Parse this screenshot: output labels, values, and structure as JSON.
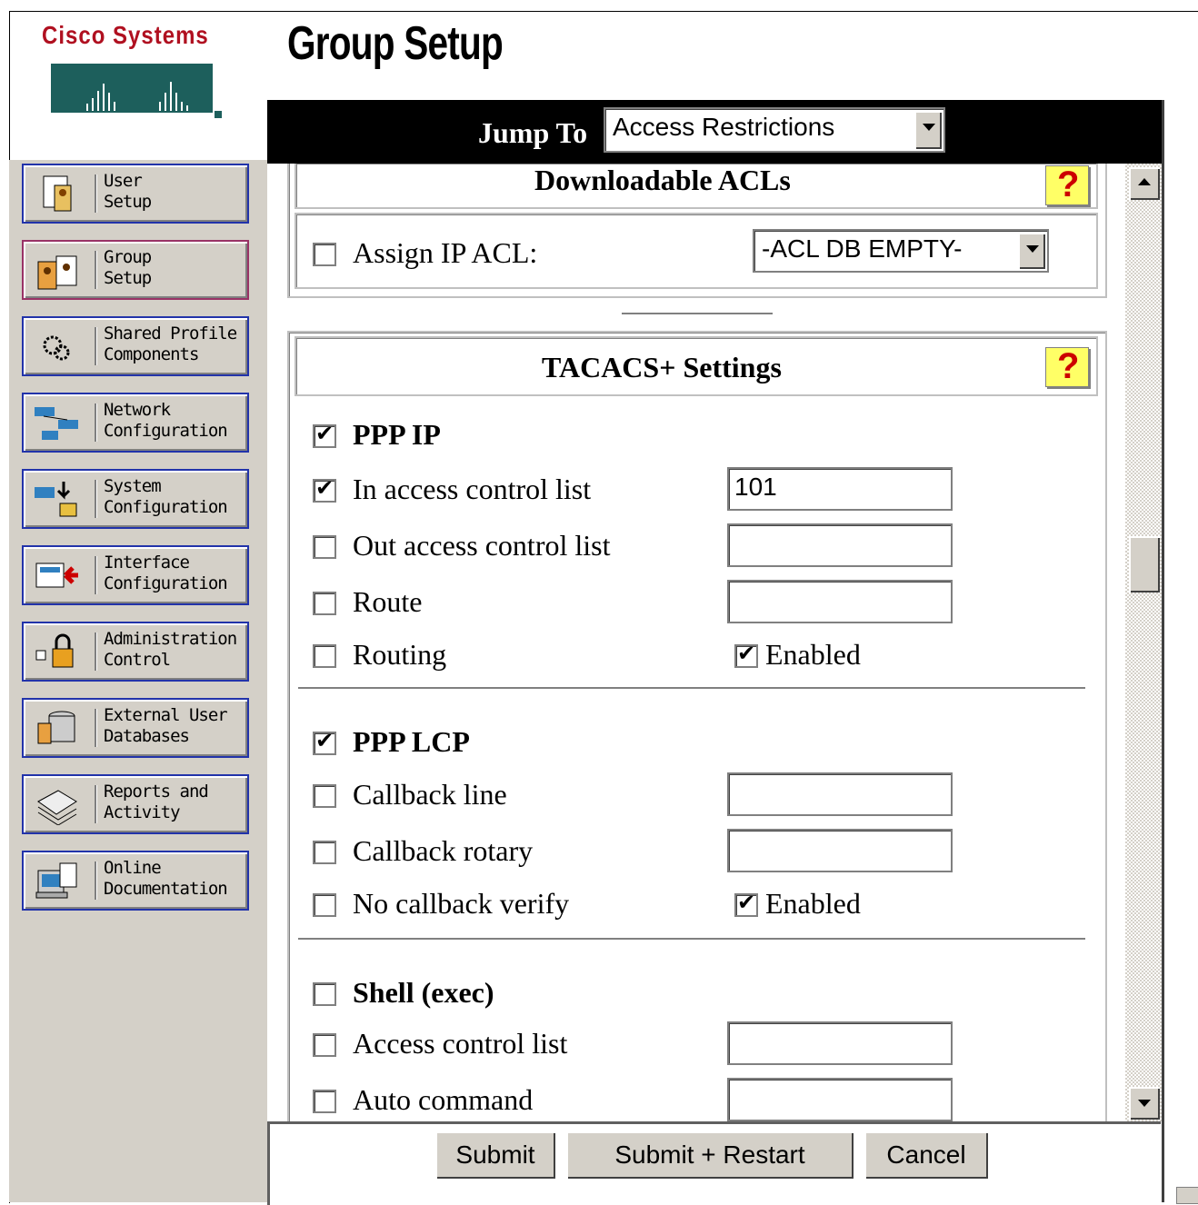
{
  "header": {
    "brand": "Cisco Systems",
    "page_title": "Group Setup"
  },
  "nav": {
    "items": [
      {
        "label": "User\nSetup",
        "icon": "user-setup-icon"
      },
      {
        "label": "Group\nSetup",
        "icon": "group-setup-icon",
        "active": true
      },
      {
        "label": "Shared Profile\nComponents",
        "icon": "gears-icon"
      },
      {
        "label": "Network\nConfiguration",
        "icon": "network-icon"
      },
      {
        "label": "System\nConfiguration",
        "icon": "system-icon"
      },
      {
        "label": "Interface\nConfiguration",
        "icon": "interface-icon"
      },
      {
        "label": "Administration\nControl",
        "icon": "admin-lock-icon"
      },
      {
        "label": "External User\nDatabases",
        "icon": "database-icon"
      },
      {
        "label": "Reports and\nActivity",
        "icon": "reports-icon"
      },
      {
        "label": "Online\nDocumentation",
        "icon": "documentation-icon"
      }
    ]
  },
  "jump": {
    "label": "Jump To",
    "selected": "Access Restrictions"
  },
  "downloadable_acls": {
    "title": "Downloadable ACLs",
    "assign_label": "Assign IP ACL:",
    "assign_checked": false,
    "acl_selected": "-ACL DB EMPTY-"
  },
  "tacacs": {
    "title": "TACACS+ Settings",
    "ppp_ip": {
      "label": "PPP IP",
      "checked": true,
      "in_acl": {
        "label": "In access control list",
        "checked": true,
        "value": "101"
      },
      "out_acl": {
        "label": "Out access control list",
        "checked": false,
        "value": ""
      },
      "route": {
        "label": "Route",
        "checked": false,
        "value": ""
      },
      "routing": {
        "label": "Routing",
        "checked": false,
        "enabled_label": "Enabled",
        "enabled_checked": true
      }
    },
    "ppp_lcp": {
      "label": "PPP LCP",
      "checked": true,
      "callback_line": {
        "label": "Callback line",
        "checked": false,
        "value": ""
      },
      "callback_rotary": {
        "label": "Callback rotary",
        "checked": false,
        "value": ""
      },
      "no_callback_verify": {
        "label": "No callback verify",
        "checked": false,
        "enabled_label": "Enabled",
        "enabled_checked": true
      }
    },
    "shell": {
      "label": "Shell (exec)",
      "checked": false,
      "acl": {
        "label": "Access control list",
        "checked": false,
        "value": ""
      },
      "auto_command": {
        "label": "Auto command",
        "checked": false,
        "value": ""
      }
    }
  },
  "footer": {
    "submit": "Submit",
    "submit_restart": "Submit + Restart",
    "cancel": "Cancel"
  },
  "colors": {
    "nav_border": "#2233aa",
    "nav_active_border": "#993366",
    "brand_red": "#b01020",
    "help_bg": "#ffff66"
  }
}
